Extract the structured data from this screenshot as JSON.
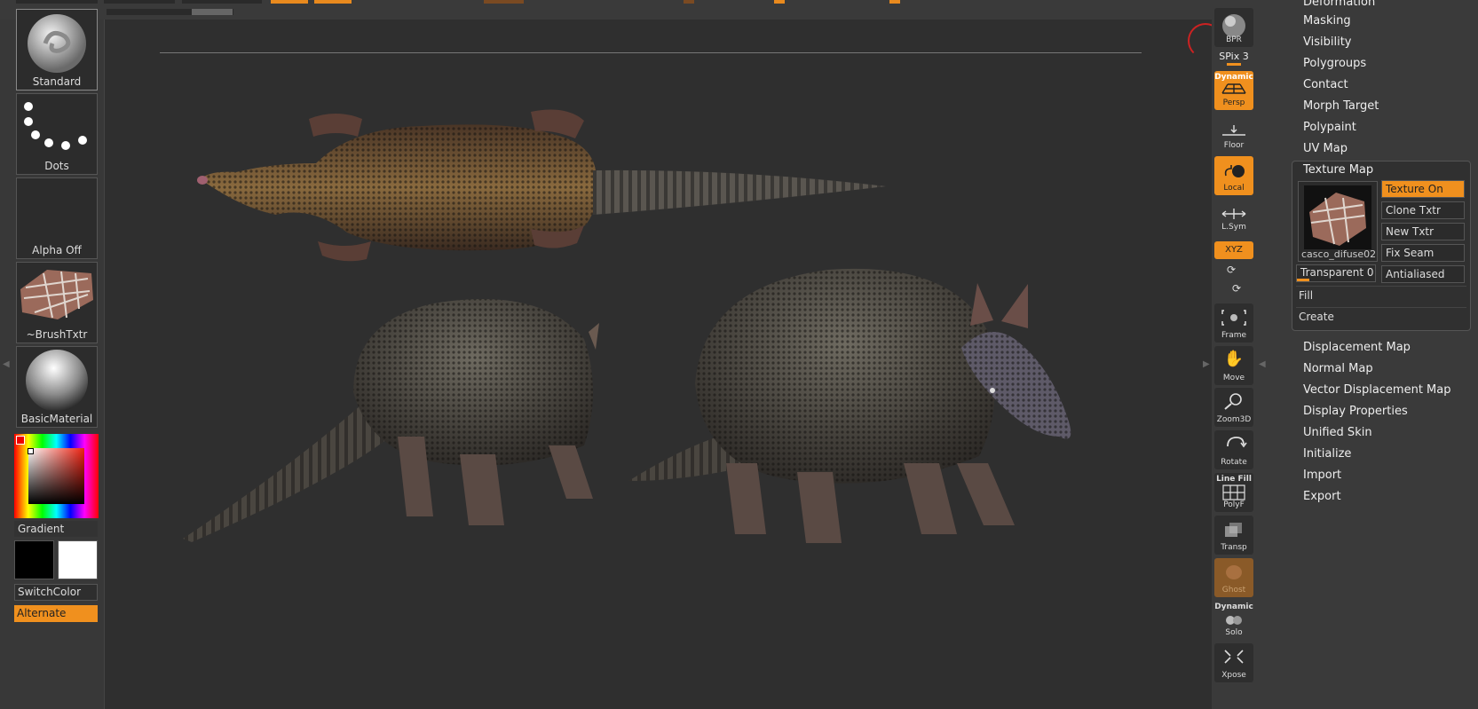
{
  "left_palette": {
    "brush_label": "Standard",
    "stroke_label": "Dots",
    "alpha_label": "Alpha Off",
    "texture_label": "~BrushTxtr",
    "material_label": "BasicMaterial",
    "gradient_label": "Gradient",
    "switchcolor_label": "SwitchColor",
    "alternate_label": "Alternate"
  },
  "toolbar": {
    "bpr_label": "BPR",
    "spix_label": "SPix 3",
    "persp_top": "Dynamic",
    "persp_label": "Persp",
    "floor_label": "Floor",
    "local_label": "Local",
    "lsym_label": "L.Sym",
    "xyz_label": "XYZ",
    "frame_label": "Frame",
    "move_label": "Move",
    "zoom_label": "Zoom3D",
    "rotate_label": "Rotate",
    "polyf_top": "Line Fill",
    "polyf_label": "PolyF",
    "transp_label": "Transp",
    "ghost_label": "Ghost",
    "solo_top": "Dynamic",
    "solo_label": "Solo",
    "xpose_label": "Xpose"
  },
  "menu": {
    "items_top": [
      "Deformation",
      "Masking",
      "Visibility",
      "Polygroups",
      "Contact",
      "Morph Target",
      "Polypaint",
      "UV Map"
    ],
    "texture_map": {
      "title": "Texture Map",
      "texture_name": "casco_difuse02",
      "texture_on": "Texture On",
      "clone_txtr": "Clone Txtr",
      "new_txtr": "New Txtr",
      "fix_seam": "Fix Seam",
      "transparent": "Transparent 0",
      "antialiased": "Antialiased",
      "fill": "Fill",
      "create": "Create"
    },
    "items_bottom": [
      "Displacement Map",
      "Normal Map",
      "Vector Displacement Map",
      "Display Properties",
      "Unified Skin",
      "Initialize",
      "Import",
      "Export"
    ]
  },
  "colors": {
    "accent": "#f0901e",
    "panel": "#3a3a3a",
    "canvas": "#2f2f2f"
  }
}
